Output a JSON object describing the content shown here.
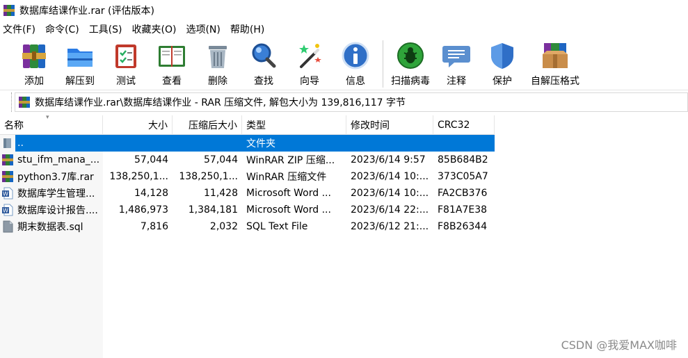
{
  "window": {
    "title": "数据库结课作业.rar (评估版本)"
  },
  "menu": [
    {
      "label": "文件(F)"
    },
    {
      "label": "命令(C)"
    },
    {
      "label": "工具(S)"
    },
    {
      "label": "收藏夹(O)"
    },
    {
      "label": "选项(N)"
    },
    {
      "label": "帮助(H)"
    }
  ],
  "toolbar": {
    "add": "添加",
    "extract_to": "解压到",
    "test": "测试",
    "view": "查看",
    "delete": "删除",
    "find": "查找",
    "wizard": "向导",
    "info": "信息",
    "virus_scan": "扫描病毒",
    "comment": "注释",
    "protect": "保护",
    "sfx": "自解压格式"
  },
  "path": {
    "text": "数据库结课作业.rar\\数据库结课作业 - RAR 压缩文件, 解包大小为 139,816,117 字节"
  },
  "columns": {
    "name": "名称",
    "size": "大小",
    "packed": "压缩后大小",
    "type": "类型",
    "modified": "修改时间",
    "crc": "CRC32"
  },
  "files": [
    {
      "name": "..",
      "size": "",
      "packed": "",
      "type": "文件夹",
      "modified": "",
      "crc": "",
      "icon": "folder-up-icon",
      "selected": true
    },
    {
      "name": "stu_ifm_mana_...",
      "size": "57,044",
      "packed": "57,044",
      "type": "WinRAR ZIP 压缩...",
      "modified": "2023/6/14 9:57",
      "crc": "85B684B2",
      "icon": "winrar-zip-icon"
    },
    {
      "name": "python3.7库.rar",
      "size": "138,250,1...",
      "packed": "138,250,1...",
      "type": "WinRAR 压缩文件",
      "modified": "2023/6/14 10:...",
      "crc": "373C05A7",
      "icon": "winrar-archive-icon"
    },
    {
      "name": "数据库学生管理...",
      "size": "14,128",
      "packed": "11,428",
      "type": "Microsoft Word ...",
      "modified": "2023/6/14 10:...",
      "crc": "FA2CB376",
      "icon": "word-document-icon"
    },
    {
      "name": "数据库设计报告....",
      "size": "1,486,973",
      "packed": "1,384,181",
      "type": "Microsoft Word ...",
      "modified": "2023/6/14 22:...",
      "crc": "F81A7E38",
      "icon": "word-document-icon"
    },
    {
      "name": "期末数据表.sql",
      "size": "7,816",
      "packed": "2,032",
      "type": "SQL Text File",
      "modified": "2023/6/12 21:...",
      "crc": "F8B26344",
      "icon": "sql-file-icon"
    }
  ],
  "watermark": "CSDN @我爱MAX咖啡",
  "colors": {
    "selection": "#0078d7"
  }
}
